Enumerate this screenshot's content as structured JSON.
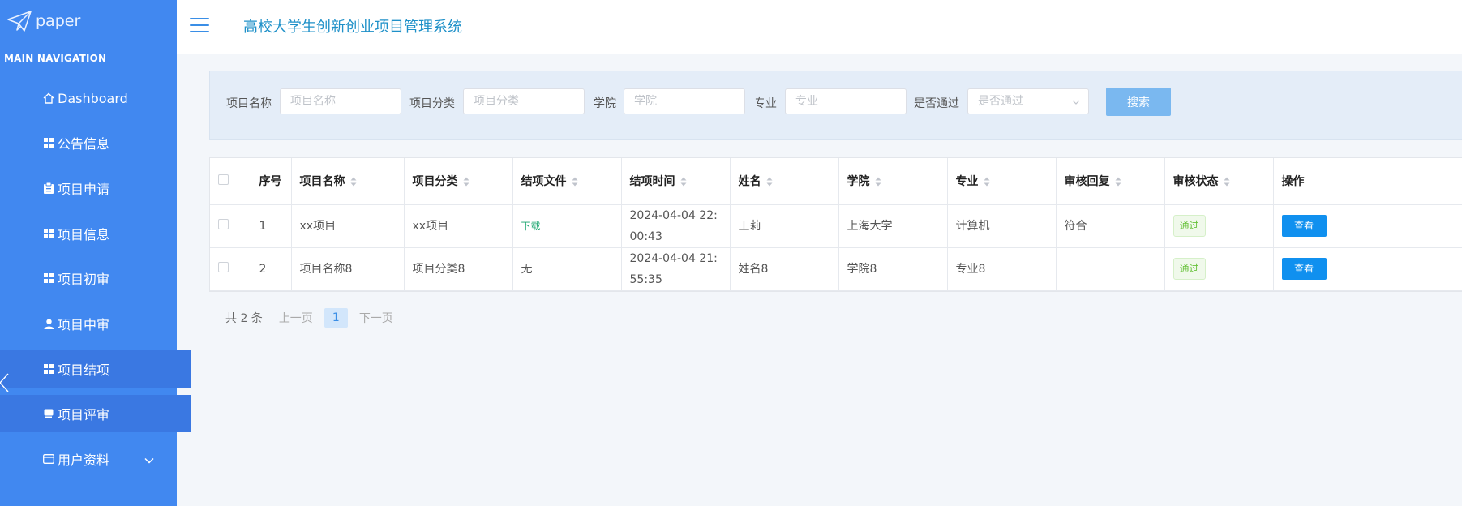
{
  "app": {
    "logo_text": "paper",
    "system_title": "高校大学生创新创业项目管理系统"
  },
  "sidebar": {
    "caption": "MAIN NAVIGATION",
    "items": [
      {
        "label": "Dashboard",
        "icon": "home-icon"
      },
      {
        "label": "公告信息",
        "icon": "grid-icon"
      },
      {
        "label": "项目申请",
        "icon": "clipboard-icon"
      },
      {
        "label": "项目信息",
        "icon": "grid-icon"
      },
      {
        "label": "项目初审",
        "icon": "grid-icon"
      },
      {
        "label": "项目中审",
        "icon": "user-icon"
      },
      {
        "label": "项目结项",
        "icon": "grid-icon"
      },
      {
        "label": "项目评审",
        "icon": "monitor-icon"
      },
      {
        "label": "用户资料",
        "icon": "card-icon"
      }
    ]
  },
  "search": {
    "fields": [
      {
        "label": "项目名称",
        "placeholder": "项目名称"
      },
      {
        "label": "项目分类",
        "placeholder": "项目分类"
      },
      {
        "label": "学院",
        "placeholder": "学院"
      },
      {
        "label": "专业",
        "placeholder": "专业"
      }
    ],
    "status_label": "是否通过",
    "status_placeholder": "是否通过",
    "button_label": "搜索"
  },
  "table": {
    "headers": [
      "序号",
      "项目名称",
      "项目分类",
      "结项文件",
      "结项时间",
      "姓名",
      "学院",
      "专业",
      "审核回复",
      "审核状态",
      "操作"
    ],
    "rows": [
      {
        "index": "1",
        "name": "xx项目",
        "category": "xx项目",
        "file": "下载",
        "time": "2024-04-04 22:00:43",
        "person": "王莉",
        "college": "上海大学",
        "major": "计算机",
        "reply": "符合",
        "status": "通过",
        "action": "查看"
      },
      {
        "index": "2",
        "name": "项目名称8",
        "category": "项目分类8",
        "file": "无",
        "time": "2024-04-04 21:55:35",
        "person": "姓名8",
        "college": "学院8",
        "major": "专业8",
        "reply": "",
        "status": "通过",
        "action": "查看"
      }
    ]
  },
  "pagination": {
    "total": "共 2 条",
    "prev": "上一页",
    "current": "1",
    "next": "下一页"
  },
  "colors": {
    "sidebar_bg": "#4188f0",
    "accent": "#1090ef",
    "title": "#1e90c8",
    "pass": "#67c23a"
  }
}
